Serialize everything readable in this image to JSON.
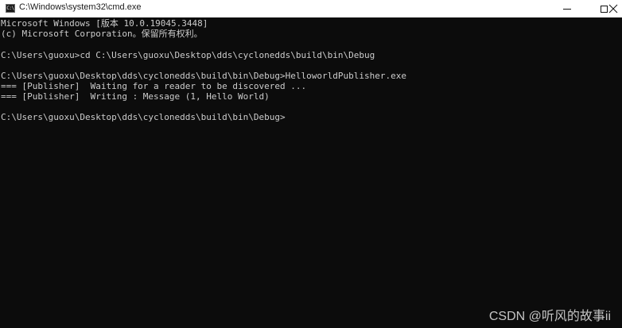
{
  "window": {
    "title": "C:\\Windows\\system32\\cmd.exe",
    "app_icon_text": "C:\\",
    "controls": {
      "minimize_icon": "minimize-icon",
      "maximize_icon": "maximize-icon",
      "close_icon": "close-icon"
    }
  },
  "console": {
    "background": "#0c0c0c",
    "foreground": "#cccccc",
    "lines": [
      "Microsoft Windows [版本 10.0.19045.3448]",
      "(c) Microsoft Corporation。保留所有权利。",
      "",
      "C:\\Users\\guoxu>cd C:\\Users\\guoxu\\Desktop\\dds\\cyclonedds\\build\\bin\\Debug",
      "",
      "C:\\Users\\guoxu\\Desktop\\dds\\cyclonedds\\build\\bin\\Debug>HelloworldPublisher.exe",
      "=== [Publisher]  Waiting for a reader to be discovered ...",
      "=== [Publisher]  Writing : Message (1, Hello World)",
      "",
      "C:\\Users\\guoxu\\Desktop\\dds\\cyclonedds\\build\\bin\\Debug>"
    ]
  },
  "watermark": "CSDN @听风的故事ii"
}
